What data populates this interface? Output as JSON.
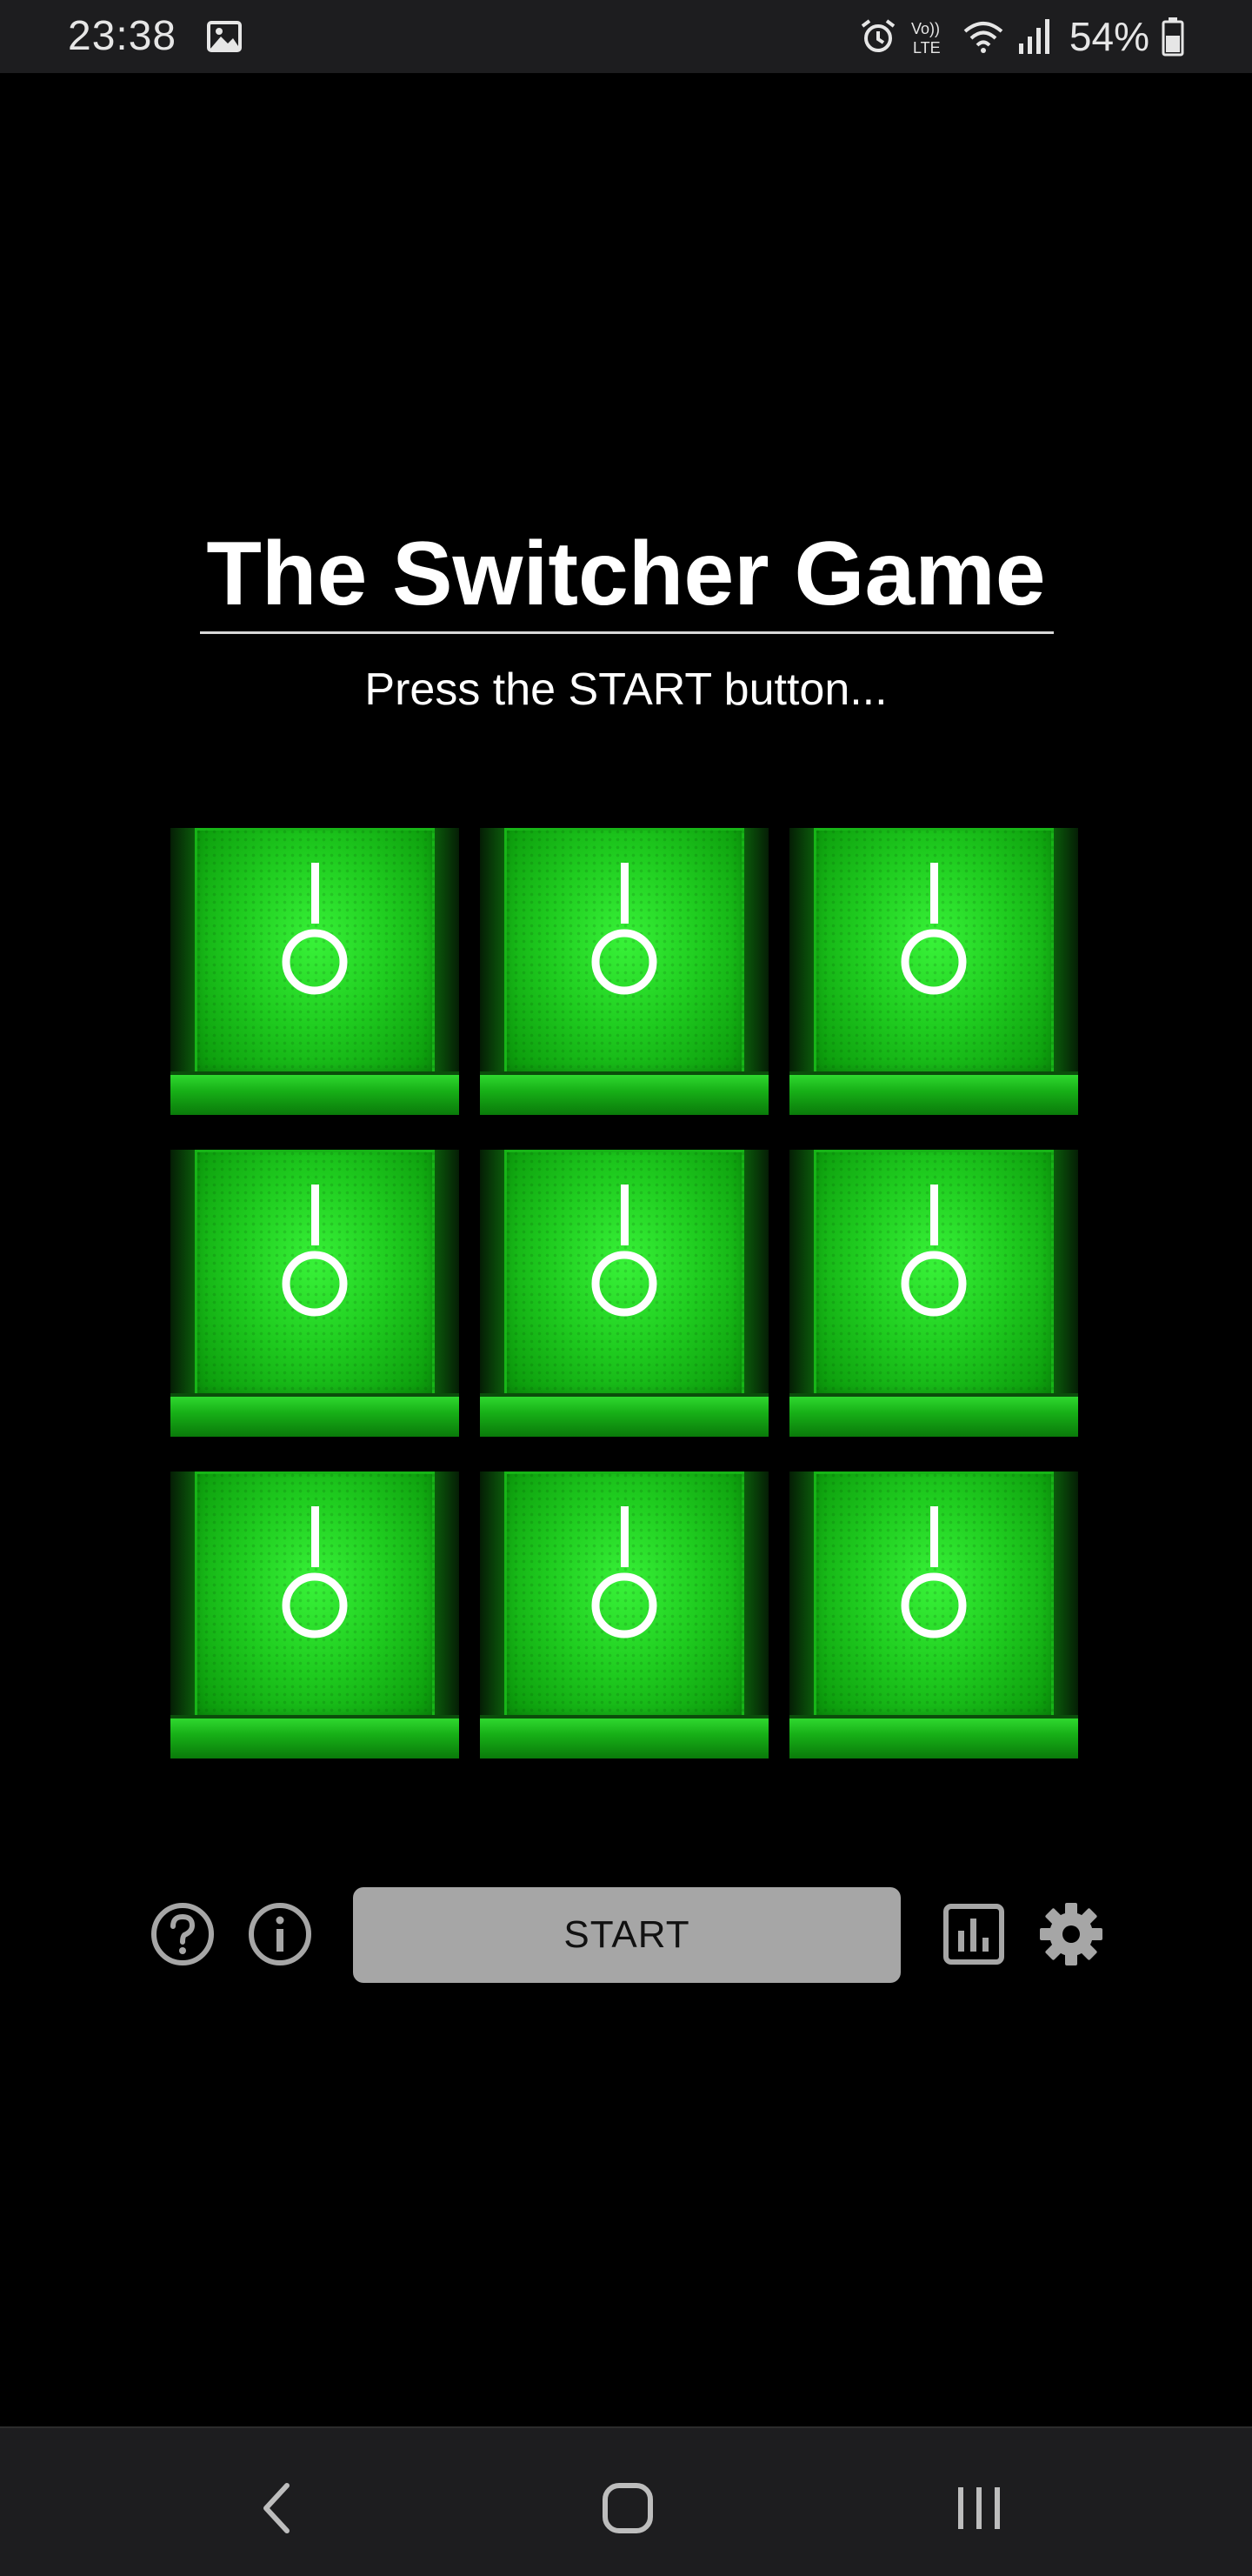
{
  "status_bar": {
    "time": "23:38",
    "battery_percent": "54%",
    "network_label": "Vo) LTE",
    "icons": [
      "image-icon",
      "alarm-icon",
      "volte-icon",
      "wifi-icon",
      "signal-icon",
      "battery-icon"
    ]
  },
  "game": {
    "title": "The Switcher Game",
    "subtitle": "Press the START button...",
    "switch_color": "#1fcc1f",
    "switches": [
      {
        "state": "on"
      },
      {
        "state": "on"
      },
      {
        "state": "on"
      },
      {
        "state": "on"
      },
      {
        "state": "on"
      },
      {
        "state": "on"
      },
      {
        "state": "on"
      },
      {
        "state": "on"
      },
      {
        "state": "on"
      }
    ]
  },
  "controls": {
    "start_label": "START",
    "icons": [
      "help-icon",
      "info-icon",
      "stats-icon",
      "settings-icon"
    ],
    "button_color": "#a6a6a6"
  },
  "nav_bar": {
    "icons": [
      "back-icon",
      "home-icon",
      "recents-icon"
    ]
  }
}
